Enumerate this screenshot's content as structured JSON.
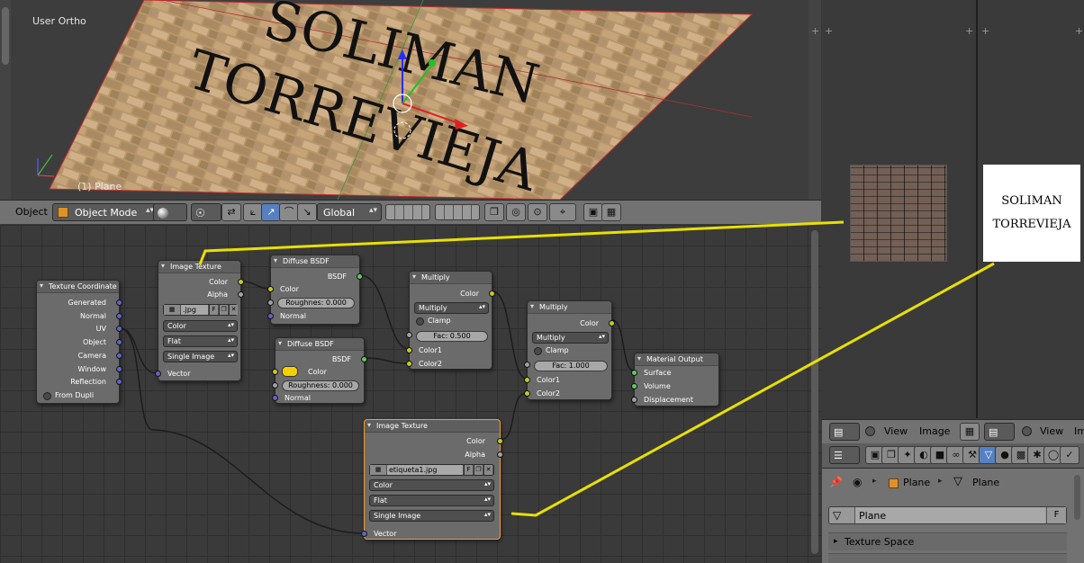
{
  "viewport": {
    "title": "User Ortho",
    "object_label": "(1) Plane",
    "plane_text_line1": "SOLIMAN",
    "plane_text_line2": "TORREVIEJA"
  },
  "viewport_header": {
    "menu_object": "Object",
    "mode": "Object Mode",
    "orientation": "Global"
  },
  "nodes": {
    "texcoord": {
      "title": "Texture Coordinate",
      "outputs": [
        "Generated",
        "Normal",
        "UV",
        "Object",
        "Camera",
        "Window",
        "Reflection"
      ],
      "from_dupli": "From Dupli"
    },
    "imgtex1": {
      "title": "Image Texture",
      "out_color": "Color",
      "out_alpha": "Alpha",
      "image": ".jpg",
      "fake_user": "F",
      "color_space": "Color",
      "projection": "Flat",
      "source": "Single Image",
      "in_vector": "Vector"
    },
    "diffuse1": {
      "title": "Diffuse BSDF",
      "out": "BSDF",
      "in_color": "Color",
      "roughness": "Roughnes: 0.000",
      "in_normal": "Normal"
    },
    "diffuse2": {
      "title": "Diffuse BSDF",
      "out": "BSDF",
      "in_color": "Color",
      "roughness": "Roughness: 0.000",
      "in_normal": "Normal",
      "color_swatch": "#f5d000"
    },
    "multiply1": {
      "title": "Multiply",
      "out": "Color",
      "blend": "Multiply",
      "clamp": "Clamp",
      "fac": "Fac: 0.500",
      "in1": "Color1",
      "in2": "Color2"
    },
    "multiply2": {
      "title": "Multiply",
      "out": "Color",
      "blend": "Multiply",
      "clamp": "Clamp",
      "fac": "Fac: 1.000",
      "in1": "Color1",
      "in2": "Color2"
    },
    "output": {
      "title": "Material Output",
      "surface": "Surface",
      "volume": "Volume",
      "displacement": "Displacement"
    },
    "imgtex2": {
      "title": "Image Texture",
      "out_color": "Color",
      "out_alpha": "Alpha",
      "image": "etiqueta1.jpg",
      "fake_user": "F",
      "color_space": "Color",
      "projection": "Flat",
      "source": "Single Image",
      "in_vector": "Vector"
    }
  },
  "image_editor_right": {
    "label_line1": "SOLIMAN",
    "label_line2": "TORREVIEJA"
  },
  "right_header": {
    "view1": "View",
    "image1": "Image",
    "view2": "View",
    "image2_partial": "Im"
  },
  "properties": {
    "breadcrumb_1": "Plane",
    "breadcrumb_2": "Plane",
    "mesh_name": "Plane",
    "fake_user": "F",
    "panel_texture_space": "Texture Space"
  },
  "colors": {
    "annotation_line": "#e8e000",
    "active_tool": "#5680c2",
    "node_active_border": "#f0a030"
  }
}
